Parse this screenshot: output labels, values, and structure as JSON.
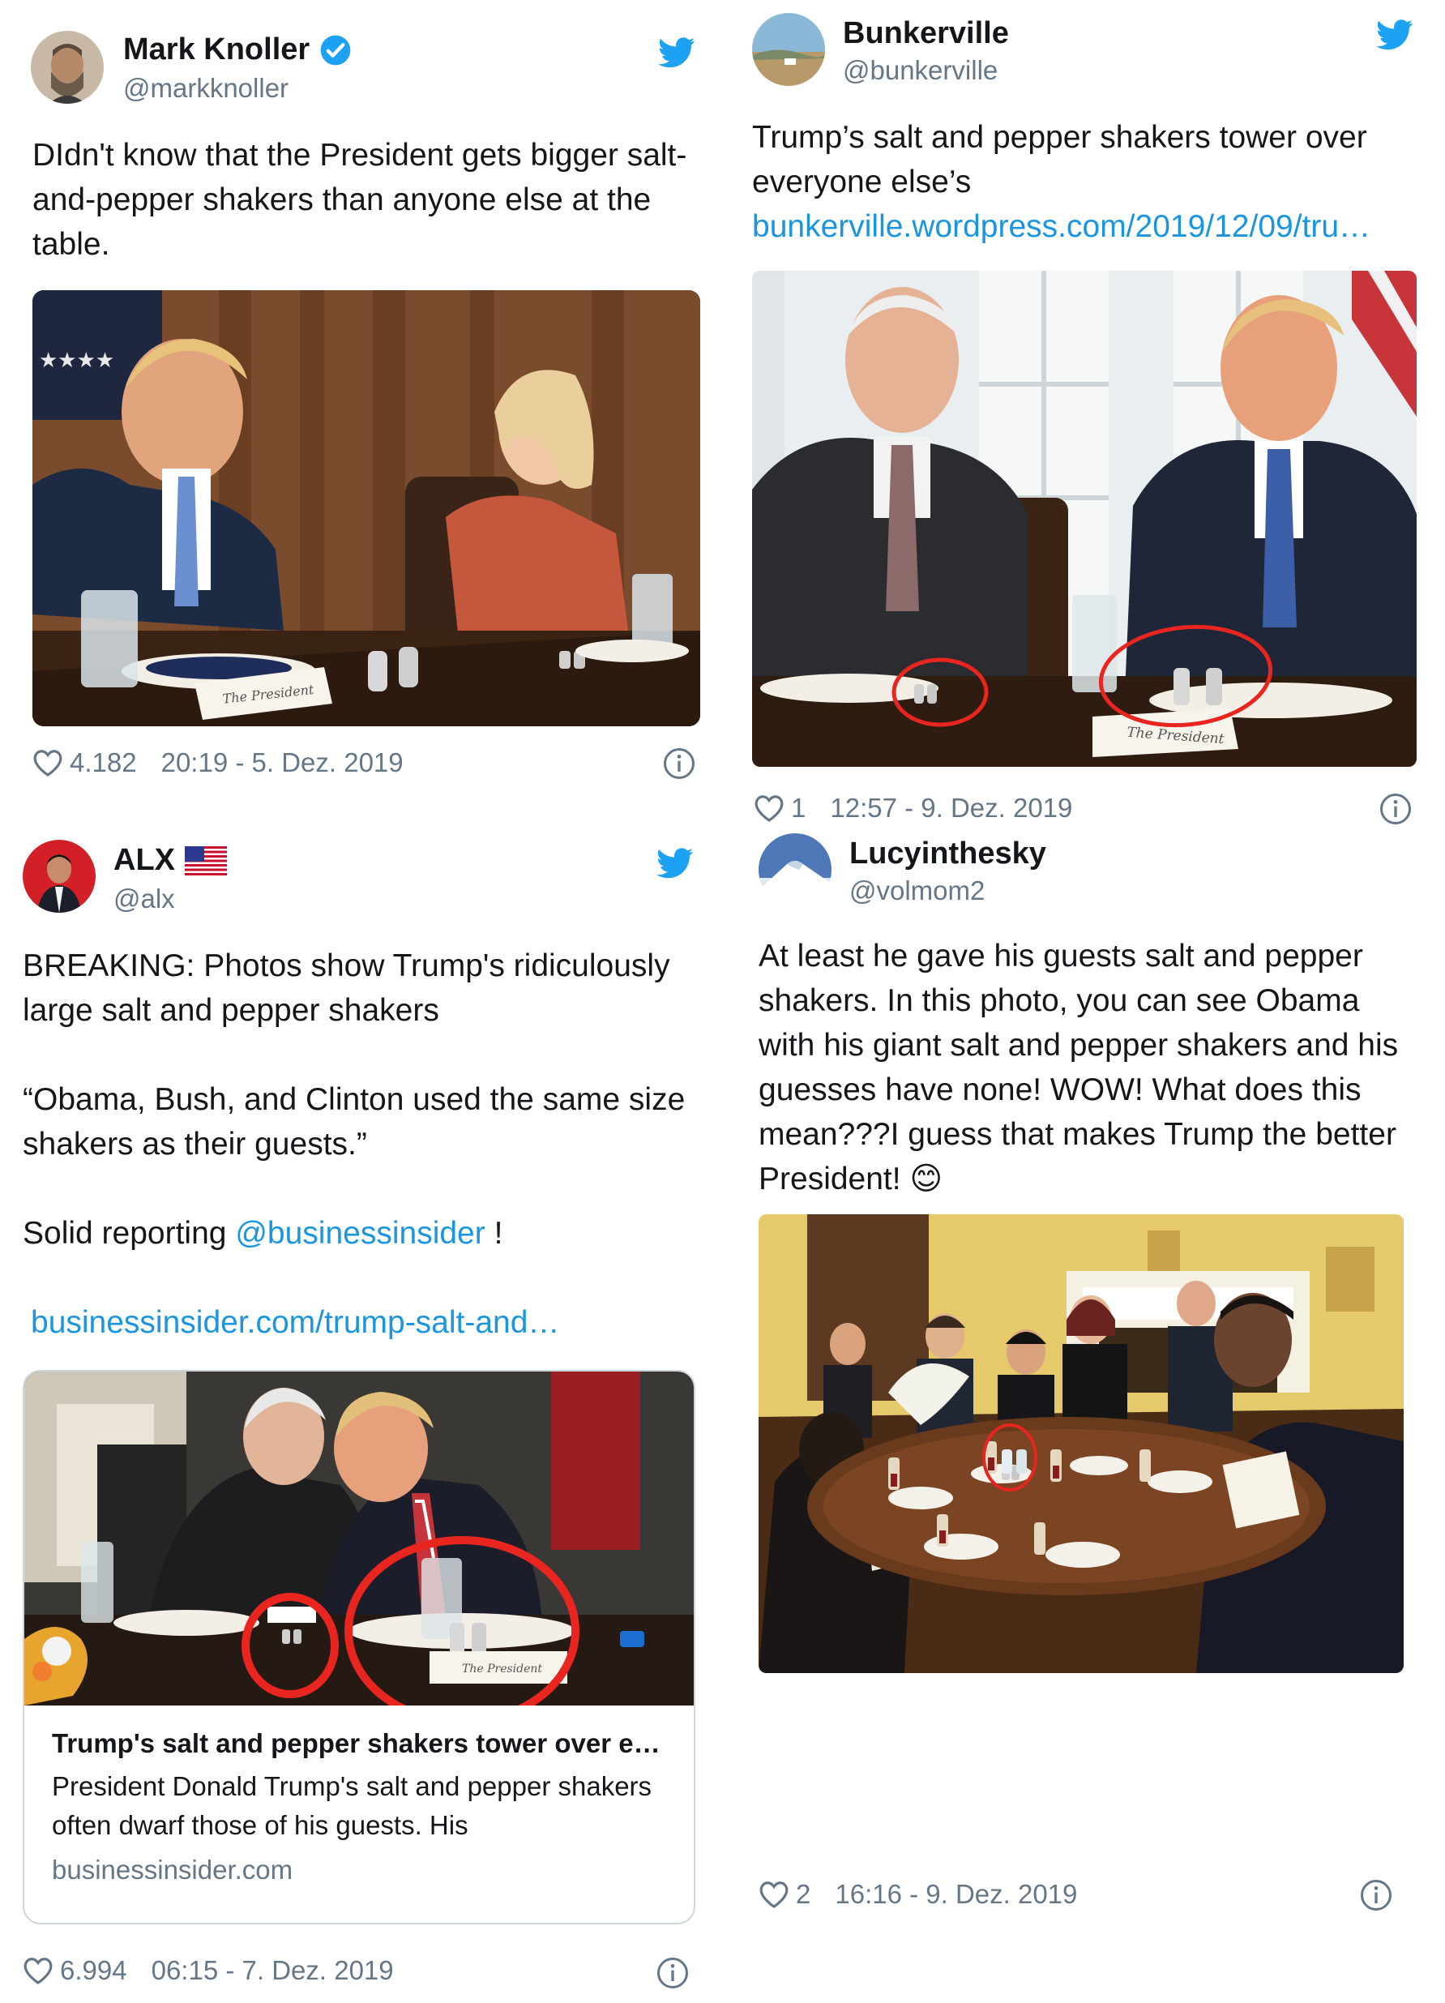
{
  "tweets": [
    {
      "name": "Mark Knoller",
      "handle": "@markknoller",
      "verified": true,
      "text": "DIdn't know that the President gets bigger salt-and-pepper shakers than anyone else at the table.",
      "likes": "4.182",
      "timestamp": "20:19 - 5. Dez. 2019",
      "photo_placard": "The President"
    },
    {
      "name": "Bunkerville",
      "handle": "@bunkerville",
      "text": "Trump’s salt and pepper shakers tower over everyone else’s",
      "link": "bunkerville.wordpress.com/2019/12/09/tru…",
      "likes": "1",
      "timestamp": "12:57 - 9. Dez. 2019",
      "photo_placard": "The President"
    },
    {
      "name": "ALX",
      "handle": "@alx",
      "flag": "🇺🇸",
      "text_1": "BREAKING: Photos show Trump's ridiculously large salt and pepper shakers",
      "text_2": "“Obama, Bush, and Clinton used the same size shakers as their guests.”",
      "text_3_prefix": "Solid reporting ",
      "mention": "@businessinsider",
      "text_3_suffix": " !",
      "link": "businessinsider.com/trump-salt-and…",
      "card": {
        "title": "Trump's salt and pepper shakers tower over e…",
        "description": "President Donald Trump's salt and pepper shakers often dwarf those of his guests. His",
        "domain": "businessinsider.com",
        "placard": "The President"
      },
      "likes": "6.994",
      "timestamp": "06:15 - 7. Dez. 2019"
    },
    {
      "name": "Lucyinthesky",
      "handle": "@volmom2",
      "text": "At least he gave his guests salt and pepper shakers. In this photo, you can see Obama with his giant salt and pepper shakers and his guesses have none! WOW! What does this mean???I guess that makes Trump the better President! 😊",
      "likes": "2",
      "timestamp": "16:16 - 9. Dez. 2019"
    }
  ],
  "colors": {
    "twitter_blue": "#1da1f2",
    "link": "#1b95e0",
    "muted": "#657786",
    "highlight_circle": "#e8251f"
  },
  "icons": [
    "twitter-bird-icon",
    "verified-badge-icon",
    "heart-icon",
    "info-icon",
    "us-flag-icon"
  ]
}
